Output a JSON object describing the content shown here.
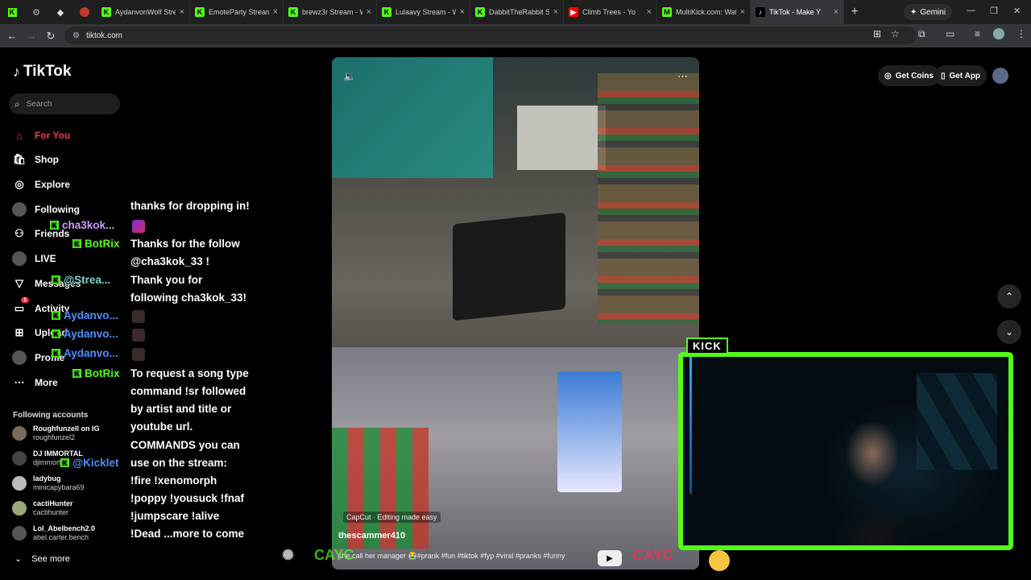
{
  "browser": {
    "tabs": [
      {
        "title": "AydanvonWolf Stre",
        "favicon": "kick"
      },
      {
        "title": "EmoteParty Stream",
        "favicon": "kick"
      },
      {
        "title": "brewz3r Stream - W",
        "favicon": "kick"
      },
      {
        "title": "Lulaavy Stream - W",
        "favicon": "kick"
      },
      {
        "title": "DabbitTheRabbit S",
        "favicon": "kick"
      },
      {
        "title": "Climb Trees - Yo",
        "favicon": "youtube"
      },
      {
        "title": "MultiKick.com: Wat",
        "favicon": "multikick"
      },
      {
        "title": "TikTok - Make Y",
        "favicon": "tiktok",
        "active": true
      }
    ],
    "gemini_label": "Gemini",
    "url": "tiktok.com"
  },
  "tiktok": {
    "logo": "TikTok",
    "search_placeholder": "Search",
    "nav": [
      {
        "label": "For You",
        "icon": "home-icon",
        "active": true
      },
      {
        "label": "Shop",
        "icon": "shop-icon"
      },
      {
        "label": "Explore",
        "icon": "compass-icon"
      },
      {
        "label": "Following",
        "icon": "avatar-icon"
      },
      {
        "label": "Friends",
        "icon": "friends-icon"
      },
      {
        "label": "LIVE",
        "icon": "live-icon"
      },
      {
        "label": "Messages",
        "icon": "send-icon"
      },
      {
        "label": "Activity",
        "icon": "activity-icon",
        "badge": "1"
      },
      {
        "label": "Upload",
        "icon": "upload-icon"
      },
      {
        "label": "Profile",
        "icon": "profile-icon"
      },
      {
        "label": "More",
        "icon": "more-icon"
      }
    ],
    "following_title": "Following accounts",
    "accounts": [
      {
        "name": "Roughfunzell on IG",
        "handle": "roughfunzel2"
      },
      {
        "name": "DJ IMMORTAL",
        "handle": "djimmortal"
      },
      {
        "name": "ladybug",
        "handle": "minicapybara69"
      },
      {
        "name": "cactiHunter",
        "handle": "cactihunter"
      },
      {
        "name": "Lol_Abelbench2.0",
        "handle": "abel.carter.bench"
      }
    ],
    "see_more": "See more",
    "get_coins": "Get Coins",
    "get_app": "Get App"
  },
  "video": {
    "capcut": "CapCut · Editing made easy",
    "author": "thescammer410",
    "description": "she call her manager 😭#prank #fun #tiktok #fyp #viral #pranks #funny"
  },
  "overlay": {
    "chat": [
      {
        "user": "",
        "text": "thanks for dropping in!"
      },
      {
        "user": "cha3kok...",
        "text": ""
      },
      {
        "user": "BotRix",
        "text": "Thanks for the follow"
      },
      {
        "user": "",
        "text": "@cha3kok_33 !"
      },
      {
        "user": "@Strea...",
        "text": "Thank you for"
      },
      {
        "user": "",
        "text": "following cha3kok_33!"
      },
      {
        "user": "Aydanvo...",
        "text": ""
      },
      {
        "user": "Aydanvo...",
        "text": ""
      },
      {
        "user": "Aydanvo...",
        "text": ""
      },
      {
        "user": "BotRix",
        "text": "To request a song type"
      },
      {
        "user": "",
        "text": "command !sr followed"
      },
      {
        "user": "",
        "text": "by artist and title or"
      },
      {
        "user": "",
        "text": "youtube url."
      },
      {
        "user": "",
        "text": "COMMANDS you can"
      },
      {
        "user": "@Kicklet",
        "text": "use on the stream:"
      },
      {
        "user": "",
        "text": "!fire !xenomorph"
      },
      {
        "user": "",
        "text": "!poppy !yousuck !fnaf"
      },
      {
        "user": "",
        "text": "!jumpscare !alive"
      },
      {
        "user": "",
        "text": "!Dead ...more to come"
      }
    ],
    "kick_label": "KICK",
    "bottom_left": "CAYC",
    "bottom_right": "CAYC"
  },
  "colors": {
    "kick_green": "#53fc18",
    "tiktok_red": "#fe2c55",
    "user_purple": "#c69cff",
    "user_blue": "#4a90ff",
    "user_teal": "#7fd6c8"
  }
}
